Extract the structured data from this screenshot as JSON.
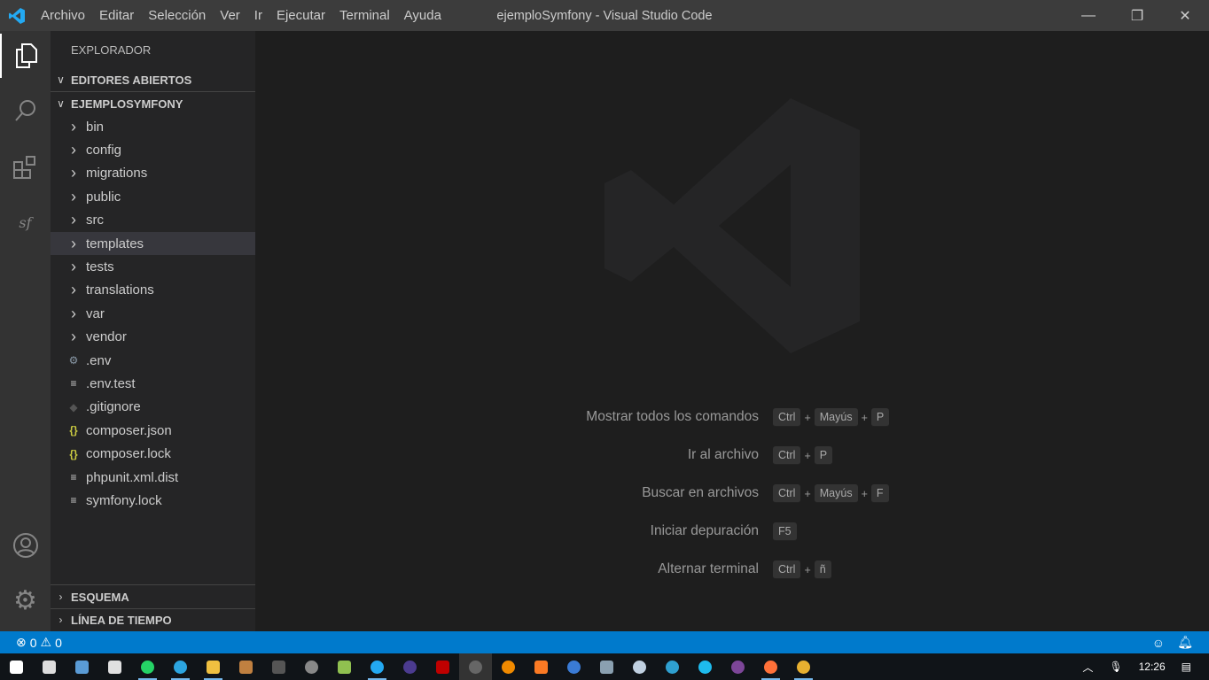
{
  "titlebar": {
    "menus": [
      "Archivo",
      "Editar",
      "Selección",
      "Ver",
      "Ir",
      "Ejecutar",
      "Terminal",
      "Ayuda"
    ],
    "title": "ejemploSymfony - Visual Studio Code",
    "minimize": "—",
    "restore": "❐",
    "close": "✕"
  },
  "activity": [
    "explorer",
    "search",
    "extensions",
    "symfony",
    "accounts",
    "settings"
  ],
  "sidebar": {
    "title": "EXPLORADOR",
    "open_editors": "EDITORES ABIERTOS",
    "project": "EJEMPLOSYMFONY",
    "items": [
      {
        "label": "bin",
        "type": "folder"
      },
      {
        "label": "config",
        "type": "folder"
      },
      {
        "label": "migrations",
        "type": "folder"
      },
      {
        "label": "public",
        "type": "folder"
      },
      {
        "label": "src",
        "type": "folder"
      },
      {
        "label": "templates",
        "type": "folder",
        "selected": true
      },
      {
        "label": "tests",
        "type": "folder"
      },
      {
        "label": "translations",
        "type": "folder"
      },
      {
        "label": "var",
        "type": "folder"
      },
      {
        "label": "vendor",
        "type": "folder"
      },
      {
        "label": ".env",
        "type": "gear"
      },
      {
        "label": ".env.test",
        "type": "text"
      },
      {
        "label": ".gitignore",
        "type": "git"
      },
      {
        "label": "composer.json",
        "type": "json"
      },
      {
        "label": "composer.lock",
        "type": "json"
      },
      {
        "label": "phpunit.xml.dist",
        "type": "text"
      },
      {
        "label": "symfony.lock",
        "type": "text"
      }
    ],
    "outline": "ESQUEMA",
    "timeline": "LÍNEA DE TIEMPO"
  },
  "shortcuts": [
    {
      "label": "Mostrar todos los comandos",
      "keys": [
        "Ctrl",
        "Mayús",
        "P"
      ]
    },
    {
      "label": "Ir al archivo",
      "keys": [
        "Ctrl",
        "P"
      ]
    },
    {
      "label": "Buscar en archivos",
      "keys": [
        "Ctrl",
        "Mayús",
        "F"
      ]
    },
    {
      "label": "Iniciar depuración",
      "keys": [
        "F5"
      ]
    },
    {
      "label": "Alternar terminal",
      "keys": [
        "Ctrl",
        "ñ"
      ]
    }
  ],
  "status": {
    "errors": "0",
    "warnings": "0"
  },
  "taskbar": {
    "apps": [
      {
        "name": "windows-start",
        "color": "#ffffff"
      },
      {
        "name": "task-view",
        "color": "#dddddd"
      },
      {
        "name": "keyboard",
        "color": "#5a9bd5"
      },
      {
        "name": "app-dark",
        "color": "#e0e0e0"
      },
      {
        "name": "whatsapp",
        "color": "#25d366",
        "open": true
      },
      {
        "name": "telegram",
        "color": "#2ca5e0",
        "open": true
      },
      {
        "name": "file-explorer",
        "color": "#f0c040",
        "open": true
      },
      {
        "name": "library",
        "color": "#c08040"
      },
      {
        "name": "terminal",
        "color": "#555555"
      },
      {
        "name": "gimp",
        "color": "#888888"
      },
      {
        "name": "notepad",
        "color": "#90c050"
      },
      {
        "name": "vscode",
        "color": "#23a9f2",
        "open": true
      },
      {
        "name": "eclipse",
        "color": "#4b3b8f"
      },
      {
        "name": "filezilla",
        "color": "#bf0000"
      },
      {
        "name": "obs",
        "color": "#666666",
        "active": true
      },
      {
        "name": "vlc",
        "color": "#f08a00"
      },
      {
        "name": "xampp",
        "color": "#fb7a24"
      },
      {
        "name": "media-player",
        "color": "#3a7bd5"
      },
      {
        "name": "remote-desktop",
        "color": "#8aa0b0"
      },
      {
        "name": "virtualbox",
        "color": "#c0d0e0"
      },
      {
        "name": "edge",
        "color": "#2fa0d0"
      },
      {
        "name": "internet-explorer",
        "color": "#1ebbee"
      },
      {
        "name": "tor",
        "color": "#7d4698"
      },
      {
        "name": "firefox",
        "color": "#ff7139",
        "open": true
      },
      {
        "name": "chrome",
        "color": "#e8b030",
        "open": true
      }
    ],
    "time": "12:26"
  }
}
